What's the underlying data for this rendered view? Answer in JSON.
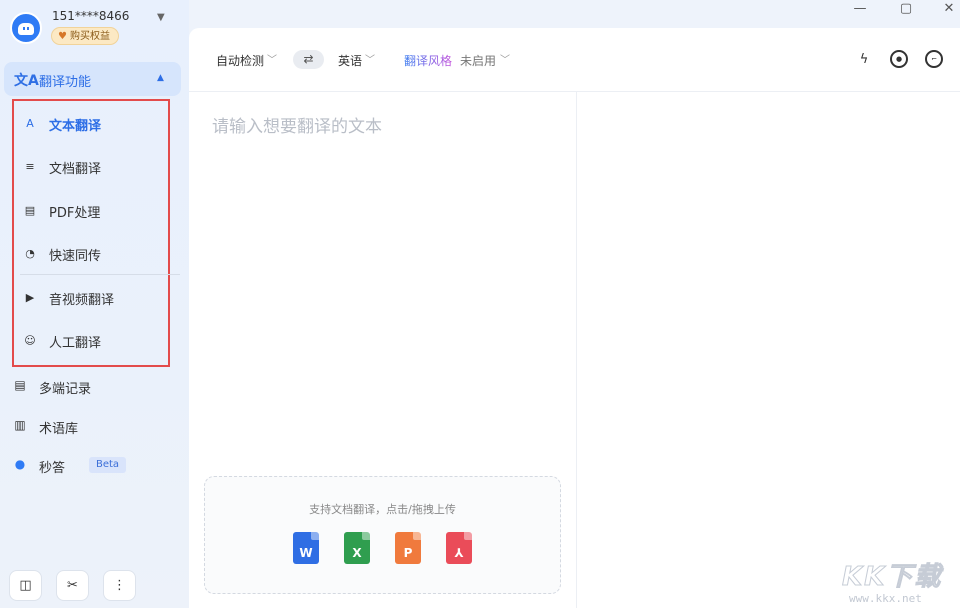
{
  "window": {
    "controls": [
      "—",
      "▢",
      "✕"
    ]
  },
  "account": {
    "phone": "151****8466",
    "buy_label": "购买权益"
  },
  "section": {
    "label": "翻译功能"
  },
  "sub_items": [
    {
      "label": "文本翻译",
      "icon": "A"
    },
    {
      "label": "文档翻译",
      "icon": "≡"
    },
    {
      "label": "PDF处理",
      "icon": "▤"
    },
    {
      "label": "快速同传",
      "icon": "◔"
    },
    {
      "label": "音视频翻译",
      "icon": "▶"
    },
    {
      "label": "人工翻译",
      "icon": "☺"
    }
  ],
  "nav": {
    "records": "多端记录",
    "termbase": "术语库",
    "miaoda": "秒答",
    "beta": "Beta"
  },
  "toolbar": {
    "source_lang": "自动检测",
    "swap": "⇄",
    "target_lang": "英语",
    "style_label": "翻译风格",
    "style_value": "未启用"
  },
  "editor": {
    "placeholder": "请输入想要翻译的文本"
  },
  "upload": {
    "hint": "支持文档翻译，点击/拖拽上传",
    "files": [
      {
        "letter": "W",
        "color": "#2f6ee4"
      },
      {
        "letter": "X",
        "color": "#2f9e4f"
      },
      {
        "letter": "P",
        "color": "#f07a3d"
      },
      {
        "letter": "⅄",
        "color": "#ea4c59"
      }
    ]
  },
  "watermark": {
    "brand": "KK下载",
    "url": "www.kkx.net"
  }
}
